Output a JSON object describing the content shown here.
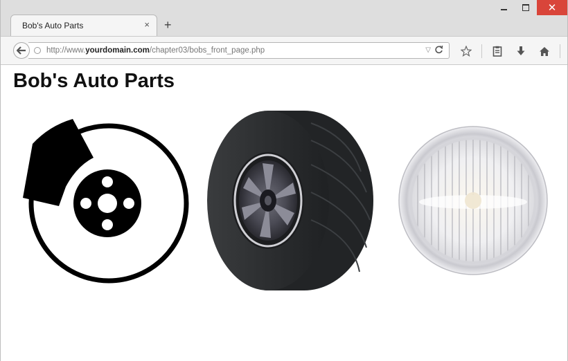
{
  "browser": {
    "tab_title": "Bob's Auto Parts",
    "tab_close_label": "×",
    "new_tab_label": "+",
    "url_prefix": "http://www.",
    "url_domain": "yourdomain.com",
    "url_path": "/chapter03/bobs_front_page.php",
    "url_dropdown_label": "▽",
    "reload_label": "C",
    "window_controls": {
      "close_label": "✕"
    }
  },
  "page": {
    "heading": "Bob's Auto Parts",
    "images": [
      {
        "name": "brake-disc",
        "icon": "brake-disc-image"
      },
      {
        "name": "tire",
        "icon": "tire-image"
      },
      {
        "name": "headlight",
        "icon": "headlight-image"
      }
    ]
  },
  "colors": {
    "window_chrome": "#dedede",
    "close_button": "#d9453a",
    "tire_dark": "#2f3133",
    "brake_black": "#000000"
  }
}
